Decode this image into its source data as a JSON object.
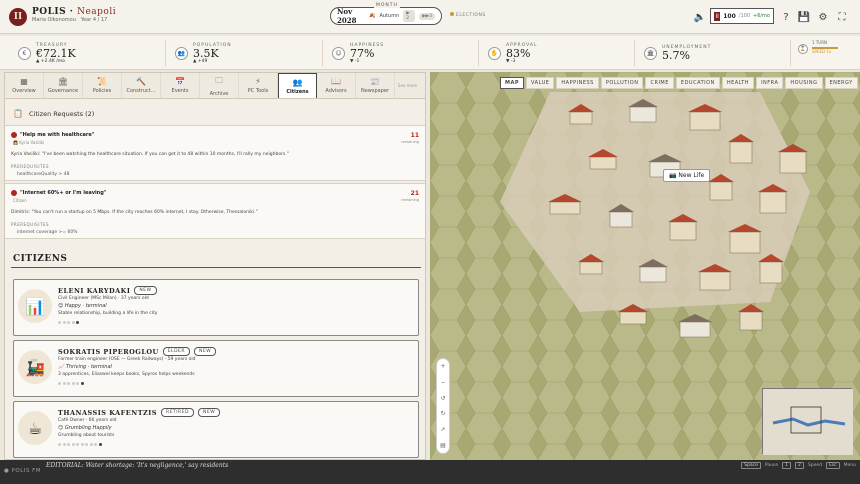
{
  "header": {
    "logo_letter": "II",
    "game": "POLIS",
    "separator": "·",
    "city": "Neapoli",
    "mayor": "Maria Oikonomou",
    "year_label": "Year 4 / 17",
    "month_label": "MONTH",
    "date": "Nov 2028",
    "season": "Autumn",
    "season_icon": "leaf-icon",
    "speed1": "2",
    "speed2": "3",
    "elections_label": "ELECTIONS",
    "resource_icon": "II",
    "resource_value": "100",
    "resource_max": "/100",
    "resource_rate": "+6/mo"
  },
  "stats": [
    {
      "label": "TREASURY",
      "value": "€72.1K",
      "change": "▲ +2.4K /mo",
      "icon": "coins-icon"
    },
    {
      "label": "POPULATION",
      "value": "3.5K",
      "change": "▲ +49",
      "icon": "people-icon"
    },
    {
      "label": "HAPPINESS",
      "value": "77%",
      "change": "▼ -1",
      "icon": "smile-icon"
    },
    {
      "label": "APPROVAL",
      "value": "83%",
      "change": "▼ -3",
      "icon": "handshake-icon"
    },
    {
      "label": "UNEMPLOYMENT",
      "value": "5.7%",
      "change": "",
      "icon": "building-icon"
    }
  ],
  "turns": {
    "label": "1 TURN",
    "sub": "SPEED 1x"
  },
  "tabs": [
    {
      "label": "Overview",
      "icon": "grid-icon"
    },
    {
      "label": "Governance",
      "icon": "temple-icon"
    },
    {
      "label": "Policies",
      "icon": "scroll-icon"
    },
    {
      "label": "Construct...",
      "icon": "hammer-icon"
    },
    {
      "label": "Events",
      "icon": "calendar-icon"
    },
    {
      "label": "Archive",
      "icon": "folder-icon"
    },
    {
      "label": "PC Tools",
      "icon": "tools-icon"
    },
    {
      "label": "Citizens",
      "icon": "citizens-icon"
    },
    {
      "label": "Advisors",
      "icon": "book-icon"
    },
    {
      "label": "Newspaper",
      "icon": "newspaper-icon"
    }
  ],
  "tab_more": "See more",
  "requests_header": "Citizen Requests (2)",
  "requests": [
    {
      "title": "\"Help me with healthcare\"",
      "who": "Kyria Vasiliki",
      "quote": "Kyria Vasiliki: \"I've been watching the healthcare situation. If you can get it to 48 within 10 months, I'll rally my neighbors.\"",
      "prereq_label": "PREREQUISITES",
      "condition": "healthcareQuality > 48",
      "turns": "11",
      "turns_label": "remaining"
    },
    {
      "title": "\"Internet 60%+ or I'm leaving\"",
      "who": "Citizen",
      "quote": "Dimitris: \"You can't run a startup on 5 Mbps. If the city reaches 60% internet, I stay. Otherwise, Thessaloniki.\"",
      "prereq_label": "PREREQUISITES",
      "condition": "internet coverage >= 60%",
      "turns": "21",
      "turns_label": "remaining"
    }
  ],
  "citizens_title": "CITIZENS",
  "citizens": [
    {
      "name": "ELENI KARYDAKI",
      "badges": [
        "NEW"
      ],
      "job": "Civil Engineer (MSc Milan) · 37 years old",
      "mood": "Happy · terminal",
      "mood_icon": "😊",
      "note": "Stable relationship, building a life in the city",
      "portrait": "📊",
      "dots": 5,
      "active_dot": 5
    },
    {
      "name": "SOKRATIS PIPEROGLOU",
      "badges": [
        "ELDER",
        "NEW"
      ],
      "job": "Former train engineer (OSE — Greek Railways) · 59 years old",
      "mood": "Thriving · terminal",
      "mood_icon": "📈",
      "note": "3 apprentices, Eliaswel keeps books, Spyros helps weekends",
      "portrait": "🚂",
      "dots": 6,
      "active_dot": 6
    },
    {
      "name": "THANASSIS KAFENTZIS",
      "badges": [
        "RETIRED",
        "NEW"
      ],
      "job": "Café Owner · 66 years old",
      "mood": "Grumbling Happily",
      "mood_icon": "😏",
      "note": "Grumbling about tourists",
      "portrait": "☕",
      "dots": 10,
      "active_dot": 10
    }
  ],
  "map_tabs": [
    "MAP",
    "VALUE",
    "HAPPINESS",
    "POLLUTION",
    "CRIME",
    "EDUCATION",
    "HEALTH",
    "INFRA",
    "HOUSING",
    "ENERGY"
  ],
  "map_tooltip": "New Life",
  "map_tooltip_icon": "camera-icon",
  "ticker": {
    "label": "POLIS FM",
    "headline": "EDITORIAL: Water shortage: 'It's negligence,' say residents",
    "hint1": "Space",
    "hint1_text": "Pause",
    "hint2": "1",
    "hint3": "2",
    "hint2_text": "Speed",
    "hint4": "Esc",
    "hint4_text": "Menu"
  }
}
